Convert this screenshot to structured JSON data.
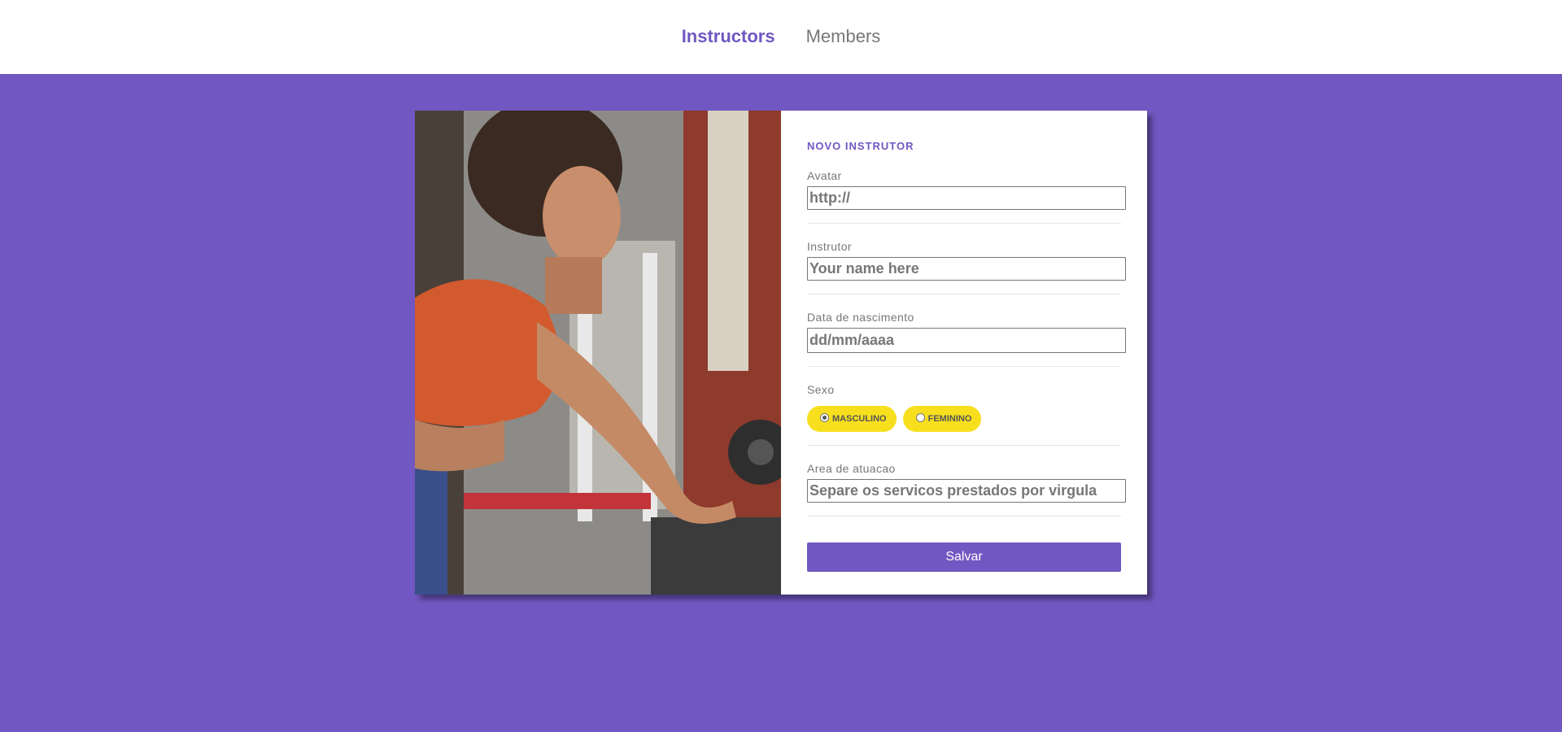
{
  "nav": {
    "items": [
      {
        "label": "Instructors",
        "active": true
      },
      {
        "label": "Members",
        "active": false
      }
    ]
  },
  "form": {
    "title": "NOVO INSTRUTOR",
    "avatar": {
      "label": "Avatar",
      "placeholder": "http://"
    },
    "instructor": {
      "label": "Instrutor",
      "placeholder": "Your name here"
    },
    "birth": {
      "label": "Data de nascimento",
      "placeholder": "dd/mm/aaaa"
    },
    "gender": {
      "label": "Sexo",
      "options": [
        {
          "label": "MASCULINO",
          "checked": true
        },
        {
          "label": "FEMININO",
          "checked": false
        }
      ]
    },
    "area": {
      "label": "Area de atuacao",
      "placeholder": "Separe os servicos prestados por virgula"
    },
    "submit_label": "Salvar"
  },
  "colors": {
    "accent": "#7157c1",
    "pill": "#f7df1e",
    "text_muted": "#777777"
  }
}
